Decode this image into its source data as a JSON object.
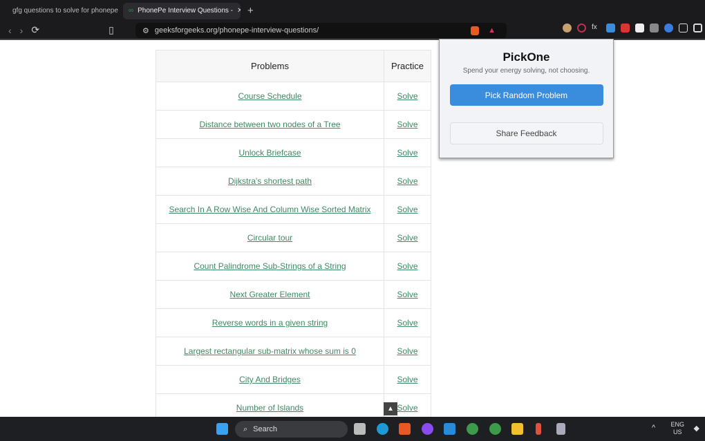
{
  "browser": {
    "tabs": [
      {
        "label": "gfg questions to solve for phonepe"
      },
      {
        "label": "PhonePe Interview Questions -"
      }
    ],
    "url": "geeksforgeeks.org/phonepe-interview-questions/"
  },
  "table": {
    "headers": [
      "Problems",
      "Practice"
    ],
    "rows": [
      {
        "problem": "Course Schedule",
        "practice": "Solve"
      },
      {
        "problem": "Distance between two nodes of a Tree",
        "practice": "Solve"
      },
      {
        "problem": "Unlock Briefcase",
        "practice": "Solve"
      },
      {
        "problem": "Dijkstra's shortest path",
        "practice": "Solve"
      },
      {
        "problem": "Search In A Row Wise And Column Wise Sorted Matrix",
        "practice": "Solve"
      },
      {
        "problem": "Circular tour",
        "practice": "Solve"
      },
      {
        "problem": "Count Palindrome Sub-Strings of a String",
        "practice": "Solve"
      },
      {
        "problem": "Next Greater Element",
        "practice": "Solve"
      },
      {
        "problem": "Reverse words in a given string",
        "practice": "Solve"
      },
      {
        "problem": "Largest rectangular sub-matrix whose sum is 0",
        "practice": "Solve"
      },
      {
        "problem": "City And Bridges",
        "practice": "Solve"
      },
      {
        "problem": "Number of Islands",
        "practice": "Solve"
      }
    ]
  },
  "popup": {
    "title": "PickOne",
    "subtitle": "Spend your energy solving, not choosing.",
    "pick_label": "Pick Random Problem",
    "feedback_label": "Share Feedback"
  },
  "taskbar": {
    "search": "Search",
    "lang": "ENG",
    "region": "US"
  },
  "colors": {
    "link": "#3e8a62",
    "accent": "#3a8ddd"
  }
}
